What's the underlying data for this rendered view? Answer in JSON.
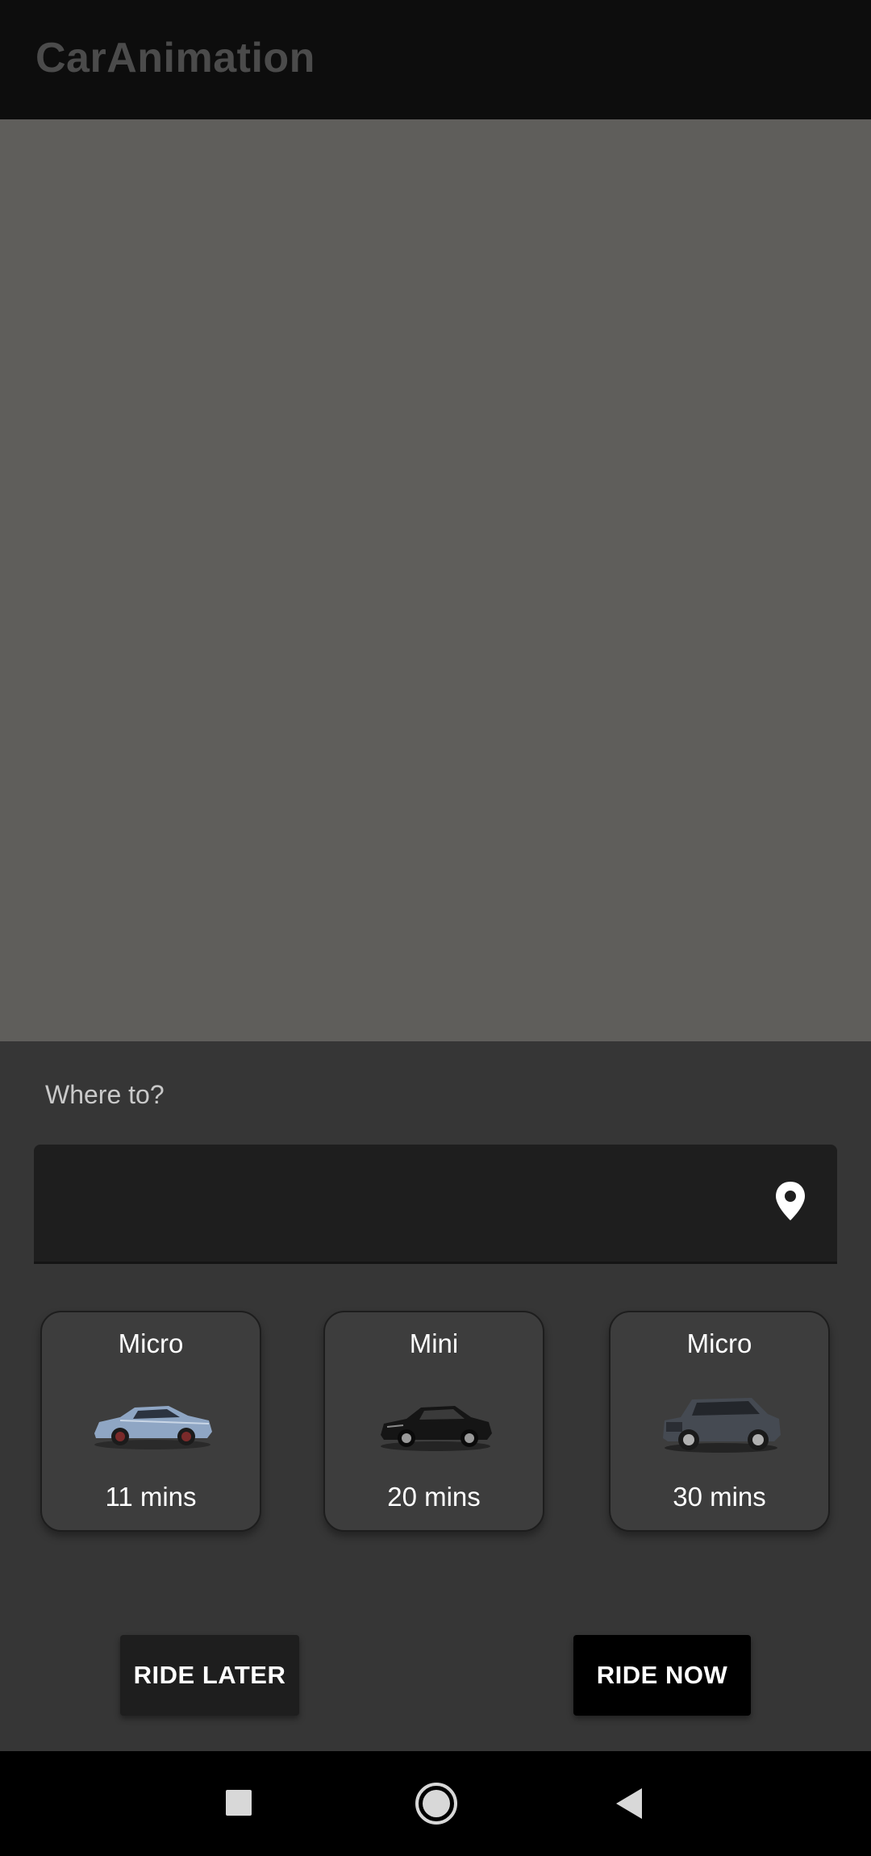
{
  "app_bar": {
    "title": "CarAnimation"
  },
  "map": {
    "background_color": "#5f5e5b"
  },
  "destination": {
    "label": "Where to?",
    "value": "",
    "placeholder": "",
    "icon": "map-pin-icon"
  },
  "ride_options": [
    {
      "name": "Micro",
      "eta": "11 mins",
      "car_color": "#8fa6c4",
      "icon": "car-sport-coupe"
    },
    {
      "name": "Mini",
      "eta": "20 mins",
      "car_color": "#151515",
      "icon": "car-sedan"
    },
    {
      "name": "Micro",
      "eta": "30 mins",
      "car_color": "#454a52",
      "icon": "car-suv"
    }
  ],
  "actions": {
    "ride_later": "RIDE LATER",
    "ride_now": "RIDE NOW"
  },
  "system_nav": {
    "recents": "square-icon",
    "home": "circle-icon",
    "back": "triangle-back-icon"
  },
  "colors": {
    "sheet": "#363636",
    "field": "#1e1e1e",
    "card": "#3d3d3d"
  }
}
